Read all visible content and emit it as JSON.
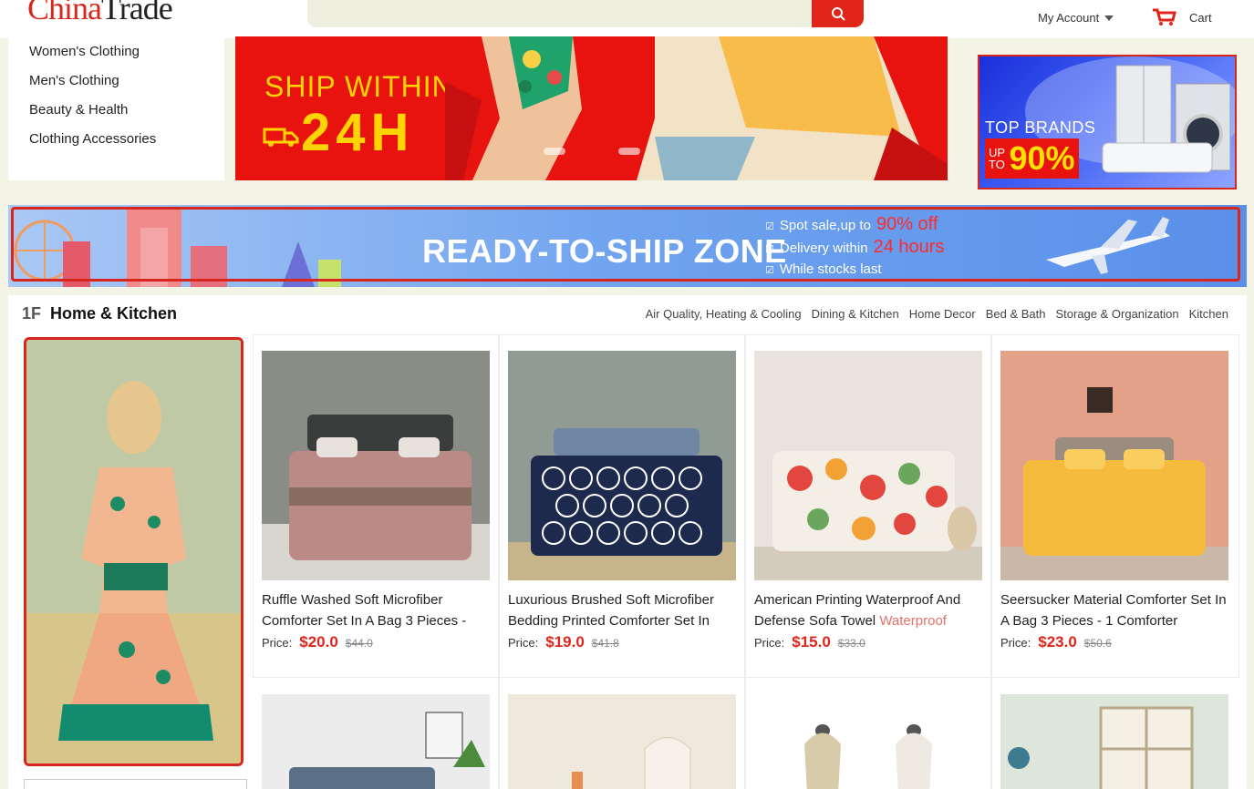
{
  "header": {
    "logo_red": "China",
    "logo_dark": "Trade",
    "account_label": "My Account",
    "cart_label": "Cart"
  },
  "categories": [
    "Women's Clothing",
    "Men's Clothing",
    "Beauty & Health",
    "Clothing Accessories"
  ],
  "hero": {
    "headline": "SHIP WITHIN",
    "big": "24H",
    "slide_count": 3,
    "active_slide": 2
  },
  "brand_ad": {
    "top": "TOP BRANDS",
    "up": "UP",
    "to": "TO",
    "discount": "90%"
  },
  "ready_to_ship": {
    "title": "READY-TO-SHIP ZONE",
    "features": [
      {
        "prefix": "Spot sale,up to",
        "highlight": "90% off"
      },
      {
        "prefix": "Delivery within",
        "highlight": "24 hours"
      },
      {
        "prefix": "While stocks last",
        "highlight": ""
      }
    ]
  },
  "floor": {
    "number": "1F",
    "title": "Home & Kitchen",
    "links": [
      "Air Quality, Heating & Cooling",
      "Dining & Kitchen",
      "Home Decor",
      "Bed & Bath",
      "Storage & Organization",
      "Kitchen"
    ]
  },
  "products": [
    {
      "name": "Ruffle Washed Soft Microfiber Comforter Set In A Bag 3 Pieces -",
      "muted": "",
      "price_label": "Price:",
      "price": "$20.0",
      "old_price": "$44.0"
    },
    {
      "name": "Luxurious Brushed Soft Microfiber Bedding Printed Comforter Set In",
      "muted": "",
      "price_label": "Price:",
      "price": "$19.0",
      "old_price": "$41.8"
    },
    {
      "name": "American Printing Waterproof And Defense Sofa Towel",
      "muted": "Waterproof",
      "price_label": "Price:",
      "price": "$15.0",
      "old_price": "$33.0"
    },
    {
      "name": "Seersucker Material Comforter Set In A Bag 3 Pieces - 1 Comforter",
      "muted": "",
      "price_label": "Price:",
      "price": "$23.0",
      "old_price": "$50.6"
    }
  ],
  "colors": {
    "brand_red": "#e0251b",
    "banner_blue": "#5a90ea",
    "page_bg": "#f3f3e6"
  }
}
